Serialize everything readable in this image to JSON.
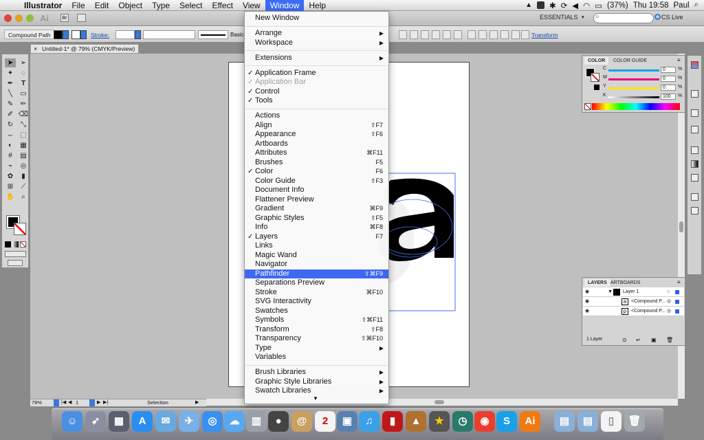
{
  "menubar": {
    "app_name": "Illustrator",
    "menus": [
      "File",
      "Edit",
      "Object",
      "Type",
      "Select",
      "Effect",
      "View",
      "Window",
      "Help"
    ],
    "active_menu": "Window",
    "battery": "(37%)",
    "clock": "Thu 19:58",
    "user": "Paul"
  },
  "appbar": {
    "logo": "Ai",
    "bridge_label": "Br",
    "workspace": "ESSENTIALS",
    "cs_live": "CS Live"
  },
  "control_bar": {
    "selection_label": "Compound Path",
    "stroke_label": "Stroke:",
    "brush_label": "Basic",
    "transform_link": "Transform"
  },
  "document": {
    "tab_title": "Untitled-1* @ 79% (CMYK/Preview)",
    "status": {
      "zoom": "79%",
      "page": "1",
      "mode": "Selection"
    }
  },
  "window_menu": [
    {
      "label": "New Window",
      "check": false,
      "shortcut": "",
      "submenu": false,
      "disabled": false
    },
    {
      "sep": true
    },
    {
      "label": "Arrange",
      "check": false,
      "shortcut": "",
      "submenu": true,
      "disabled": false
    },
    {
      "label": "Workspace",
      "check": false,
      "shortcut": "",
      "submenu": true,
      "disabled": false
    },
    {
      "sep": true
    },
    {
      "label": "Extensions",
      "check": false,
      "shortcut": "",
      "submenu": true,
      "disabled": false
    },
    {
      "sep": true
    },
    {
      "label": "Application Frame",
      "check": true,
      "shortcut": "",
      "submenu": false,
      "disabled": false
    },
    {
      "label": "Application Bar",
      "check": true,
      "shortcut": "",
      "submenu": false,
      "disabled": true
    },
    {
      "label": "Control",
      "check": true,
      "shortcut": "",
      "submenu": false,
      "disabled": false
    },
    {
      "label": "Tools",
      "check": true,
      "shortcut": "",
      "submenu": false,
      "disabled": false
    },
    {
      "sep": true
    },
    {
      "label": "Actions",
      "check": false,
      "shortcut": "",
      "submenu": false,
      "disabled": false
    },
    {
      "label": "Align",
      "check": false,
      "shortcut": "⇧F7",
      "submenu": false,
      "disabled": false
    },
    {
      "label": "Appearance",
      "check": false,
      "shortcut": "⇧F6",
      "submenu": false,
      "disabled": false
    },
    {
      "label": "Artboards",
      "check": false,
      "shortcut": "",
      "submenu": false,
      "disabled": false
    },
    {
      "label": "Attributes",
      "check": false,
      "shortcut": "⌘F11",
      "submenu": false,
      "disabled": false
    },
    {
      "label": "Brushes",
      "check": false,
      "shortcut": "F5",
      "submenu": false,
      "disabled": false
    },
    {
      "label": "Color",
      "check": true,
      "shortcut": "F6",
      "submenu": false,
      "disabled": false
    },
    {
      "label": "Color Guide",
      "check": false,
      "shortcut": "⇧F3",
      "submenu": false,
      "disabled": false
    },
    {
      "label": "Document Info",
      "check": false,
      "shortcut": "",
      "submenu": false,
      "disabled": false
    },
    {
      "label": "Flattener Preview",
      "check": false,
      "shortcut": "",
      "submenu": false,
      "disabled": false
    },
    {
      "label": "Gradient",
      "check": false,
      "shortcut": "⌘F9",
      "submenu": false,
      "disabled": false
    },
    {
      "label": "Graphic Styles",
      "check": false,
      "shortcut": "⇧F5",
      "submenu": false,
      "disabled": false
    },
    {
      "label": "Info",
      "check": false,
      "shortcut": "⌘F8",
      "submenu": false,
      "disabled": false
    },
    {
      "label": "Layers",
      "check": true,
      "shortcut": "F7",
      "submenu": false,
      "disabled": false
    },
    {
      "label": "Links",
      "check": false,
      "shortcut": "",
      "submenu": false,
      "disabled": false
    },
    {
      "label": "Magic Wand",
      "check": false,
      "shortcut": "",
      "submenu": false,
      "disabled": false
    },
    {
      "label": "Navigator",
      "check": false,
      "shortcut": "",
      "submenu": false,
      "disabled": false
    },
    {
      "label": "Pathfinder",
      "check": false,
      "shortcut": "⇧⌘F9",
      "submenu": false,
      "disabled": false,
      "highlight": true
    },
    {
      "label": "Separations Preview",
      "check": false,
      "shortcut": "",
      "submenu": false,
      "disabled": false
    },
    {
      "label": "Stroke",
      "check": false,
      "shortcut": "⌘F10",
      "submenu": false,
      "disabled": false
    },
    {
      "label": "SVG Interactivity",
      "check": false,
      "shortcut": "",
      "submenu": false,
      "disabled": false
    },
    {
      "label": "Swatches",
      "check": false,
      "shortcut": "",
      "submenu": false,
      "disabled": false
    },
    {
      "label": "Symbols",
      "check": false,
      "shortcut": "⇧⌘F11",
      "submenu": false,
      "disabled": false
    },
    {
      "label": "Transform",
      "check": false,
      "shortcut": "⇧F8",
      "submenu": false,
      "disabled": false
    },
    {
      "label": "Transparency",
      "check": false,
      "shortcut": "⇧⌘F10",
      "submenu": false,
      "disabled": false
    },
    {
      "label": "Type",
      "check": false,
      "shortcut": "",
      "submenu": true,
      "disabled": false
    },
    {
      "label": "Variables",
      "check": false,
      "shortcut": "",
      "submenu": false,
      "disabled": false
    },
    {
      "sep": true
    },
    {
      "label": "Brush Libraries",
      "check": false,
      "shortcut": "",
      "submenu": true,
      "disabled": false
    },
    {
      "label": "Graphic Style Libraries",
      "check": false,
      "shortcut": "",
      "submenu": true,
      "disabled": false
    },
    {
      "label": "Swatch Libraries",
      "check": false,
      "shortcut": "",
      "submenu": true,
      "disabled": false
    }
  ],
  "color_panel": {
    "tabs": [
      "COLOR",
      "COLOR GUIDE"
    ],
    "channels": [
      {
        "label": "C",
        "value": "0",
        "color": "#00a6e8"
      },
      {
        "label": "M",
        "value": "0",
        "color": "#e6007e"
      },
      {
        "label": "Y",
        "value": "0",
        "color": "#ffe600"
      },
      {
        "label": "K",
        "value": "100",
        "color": "#000000"
      }
    ],
    "pct": "%"
  },
  "layers_panel": {
    "tabs": [
      "LAYERS",
      "ARTBOARDS"
    ],
    "layer_name": "Layer 1",
    "sublayers": [
      "<Compound P...",
      "<Compound P..."
    ],
    "count": "1 Layer"
  },
  "colors": {
    "menu_highlight": "#3d68f0",
    "accent_blue": "#3d77d6",
    "artwork_fill": "#000000"
  }
}
